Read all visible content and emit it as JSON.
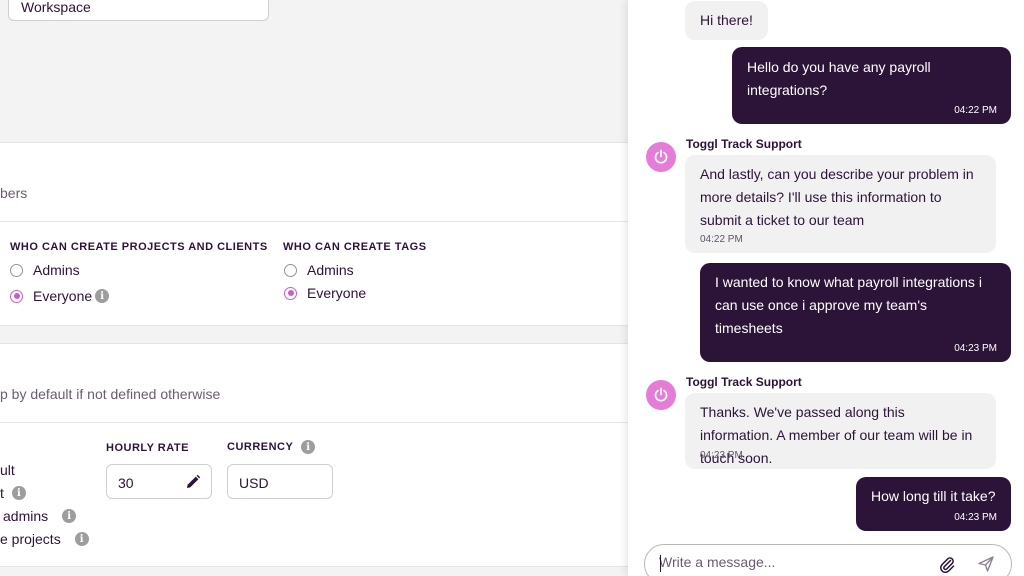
{
  "settings": {
    "workspace_input_value": "Workspace",
    "members_desc": "bers",
    "permissions": {
      "projects_heading": "WHO CAN CREATE PROJECTS AND CLIENTS",
      "projects_options": [
        {
          "label": "Admins",
          "checked": false
        },
        {
          "label": "Everyone",
          "checked": true
        }
      ],
      "tags_heading": "WHO CAN CREATE TAGS",
      "tags_options": [
        {
          "label": "Admins",
          "checked": false
        },
        {
          "label": "Everyone",
          "checked": true
        }
      ]
    },
    "rate_desc": "p by default if not defined otherwise",
    "hourly_rate_label": "HOURLY RATE",
    "hourly_rate_value": "30",
    "currency_label": "CURRENCY",
    "currency_value": "USD",
    "left_options": [
      "ult",
      "t",
      "admins",
      "e projects"
    ],
    "accent_color": "#c95fc4"
  },
  "chat": {
    "messages": [
      {
        "from": "agent",
        "text": "Hi there!",
        "time": ""
      },
      {
        "from": "user",
        "text": "Hello do you have any payroll integrations?",
        "time": "04:22 PM"
      },
      {
        "from": "agent",
        "sender": "Toggl Track Support",
        "text": "And lastly, can you describe your problem in more details? I'll use this information to submit a ticket to our team",
        "time": "04:22 PM"
      },
      {
        "from": "user",
        "text": "I wanted to know what payroll integrations i can use once i approve my team's timesheets",
        "time": "04:23 PM"
      },
      {
        "from": "agent",
        "sender": "Toggl Track Support",
        "text": "Thanks. We've passed along this information. A member of our team will be in touch soon.",
        "time": "04:23 PM"
      },
      {
        "from": "user",
        "text": "How long till it take?",
        "time": "04:23 PM"
      }
    ],
    "composer_placeholder": "Write a message...",
    "avatar_icon": "power-icon",
    "attach_icon": "paperclip-icon",
    "send_icon": "send-icon",
    "user_bubble_color": "#2c1338",
    "avatar_color": "#e57cd8"
  }
}
